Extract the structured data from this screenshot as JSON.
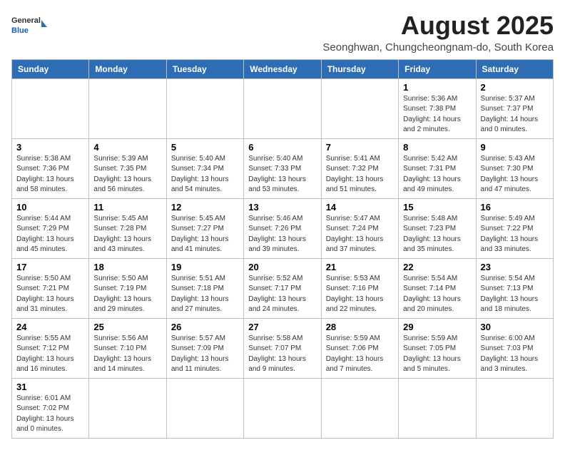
{
  "header": {
    "logo_general": "General",
    "logo_blue": "Blue",
    "month_title": "August 2025",
    "location": "Seonghwan, Chungcheongnam-do, South Korea"
  },
  "weekdays": [
    "Sunday",
    "Monday",
    "Tuesday",
    "Wednesday",
    "Thursday",
    "Friday",
    "Saturday"
  ],
  "weeks": [
    [
      {
        "day": "",
        "info": ""
      },
      {
        "day": "",
        "info": ""
      },
      {
        "day": "",
        "info": ""
      },
      {
        "day": "",
        "info": ""
      },
      {
        "day": "",
        "info": ""
      },
      {
        "day": "1",
        "info": "Sunrise: 5:36 AM\nSunset: 7:38 PM\nDaylight: 14 hours\nand 2 minutes."
      },
      {
        "day": "2",
        "info": "Sunrise: 5:37 AM\nSunset: 7:37 PM\nDaylight: 14 hours\nand 0 minutes."
      }
    ],
    [
      {
        "day": "3",
        "info": "Sunrise: 5:38 AM\nSunset: 7:36 PM\nDaylight: 13 hours\nand 58 minutes."
      },
      {
        "day": "4",
        "info": "Sunrise: 5:39 AM\nSunset: 7:35 PM\nDaylight: 13 hours\nand 56 minutes."
      },
      {
        "day": "5",
        "info": "Sunrise: 5:40 AM\nSunset: 7:34 PM\nDaylight: 13 hours\nand 54 minutes."
      },
      {
        "day": "6",
        "info": "Sunrise: 5:40 AM\nSunset: 7:33 PM\nDaylight: 13 hours\nand 53 minutes."
      },
      {
        "day": "7",
        "info": "Sunrise: 5:41 AM\nSunset: 7:32 PM\nDaylight: 13 hours\nand 51 minutes."
      },
      {
        "day": "8",
        "info": "Sunrise: 5:42 AM\nSunset: 7:31 PM\nDaylight: 13 hours\nand 49 minutes."
      },
      {
        "day": "9",
        "info": "Sunrise: 5:43 AM\nSunset: 7:30 PM\nDaylight: 13 hours\nand 47 minutes."
      }
    ],
    [
      {
        "day": "10",
        "info": "Sunrise: 5:44 AM\nSunset: 7:29 PM\nDaylight: 13 hours\nand 45 minutes."
      },
      {
        "day": "11",
        "info": "Sunrise: 5:45 AM\nSunset: 7:28 PM\nDaylight: 13 hours\nand 43 minutes."
      },
      {
        "day": "12",
        "info": "Sunrise: 5:45 AM\nSunset: 7:27 PM\nDaylight: 13 hours\nand 41 minutes."
      },
      {
        "day": "13",
        "info": "Sunrise: 5:46 AM\nSunset: 7:26 PM\nDaylight: 13 hours\nand 39 minutes."
      },
      {
        "day": "14",
        "info": "Sunrise: 5:47 AM\nSunset: 7:24 PM\nDaylight: 13 hours\nand 37 minutes."
      },
      {
        "day": "15",
        "info": "Sunrise: 5:48 AM\nSunset: 7:23 PM\nDaylight: 13 hours\nand 35 minutes."
      },
      {
        "day": "16",
        "info": "Sunrise: 5:49 AM\nSunset: 7:22 PM\nDaylight: 13 hours\nand 33 minutes."
      }
    ],
    [
      {
        "day": "17",
        "info": "Sunrise: 5:50 AM\nSunset: 7:21 PM\nDaylight: 13 hours\nand 31 minutes."
      },
      {
        "day": "18",
        "info": "Sunrise: 5:50 AM\nSunset: 7:19 PM\nDaylight: 13 hours\nand 29 minutes."
      },
      {
        "day": "19",
        "info": "Sunrise: 5:51 AM\nSunset: 7:18 PM\nDaylight: 13 hours\nand 27 minutes."
      },
      {
        "day": "20",
        "info": "Sunrise: 5:52 AM\nSunset: 7:17 PM\nDaylight: 13 hours\nand 24 minutes."
      },
      {
        "day": "21",
        "info": "Sunrise: 5:53 AM\nSunset: 7:16 PM\nDaylight: 13 hours\nand 22 minutes."
      },
      {
        "day": "22",
        "info": "Sunrise: 5:54 AM\nSunset: 7:14 PM\nDaylight: 13 hours\nand 20 minutes."
      },
      {
        "day": "23",
        "info": "Sunrise: 5:54 AM\nSunset: 7:13 PM\nDaylight: 13 hours\nand 18 minutes."
      }
    ],
    [
      {
        "day": "24",
        "info": "Sunrise: 5:55 AM\nSunset: 7:12 PM\nDaylight: 13 hours\nand 16 minutes."
      },
      {
        "day": "25",
        "info": "Sunrise: 5:56 AM\nSunset: 7:10 PM\nDaylight: 13 hours\nand 14 minutes."
      },
      {
        "day": "26",
        "info": "Sunrise: 5:57 AM\nSunset: 7:09 PM\nDaylight: 13 hours\nand 11 minutes."
      },
      {
        "day": "27",
        "info": "Sunrise: 5:58 AM\nSunset: 7:07 PM\nDaylight: 13 hours\nand 9 minutes."
      },
      {
        "day": "28",
        "info": "Sunrise: 5:59 AM\nSunset: 7:06 PM\nDaylight: 13 hours\nand 7 minutes."
      },
      {
        "day": "29",
        "info": "Sunrise: 5:59 AM\nSunset: 7:05 PM\nDaylight: 13 hours\nand 5 minutes."
      },
      {
        "day": "30",
        "info": "Sunrise: 6:00 AM\nSunset: 7:03 PM\nDaylight: 13 hours\nand 3 minutes."
      }
    ],
    [
      {
        "day": "31",
        "info": "Sunrise: 6:01 AM\nSunset: 7:02 PM\nDaylight: 13 hours\nand 0 minutes."
      },
      {
        "day": "",
        "info": ""
      },
      {
        "day": "",
        "info": ""
      },
      {
        "day": "",
        "info": ""
      },
      {
        "day": "",
        "info": ""
      },
      {
        "day": "",
        "info": ""
      },
      {
        "day": "",
        "info": ""
      }
    ]
  ]
}
